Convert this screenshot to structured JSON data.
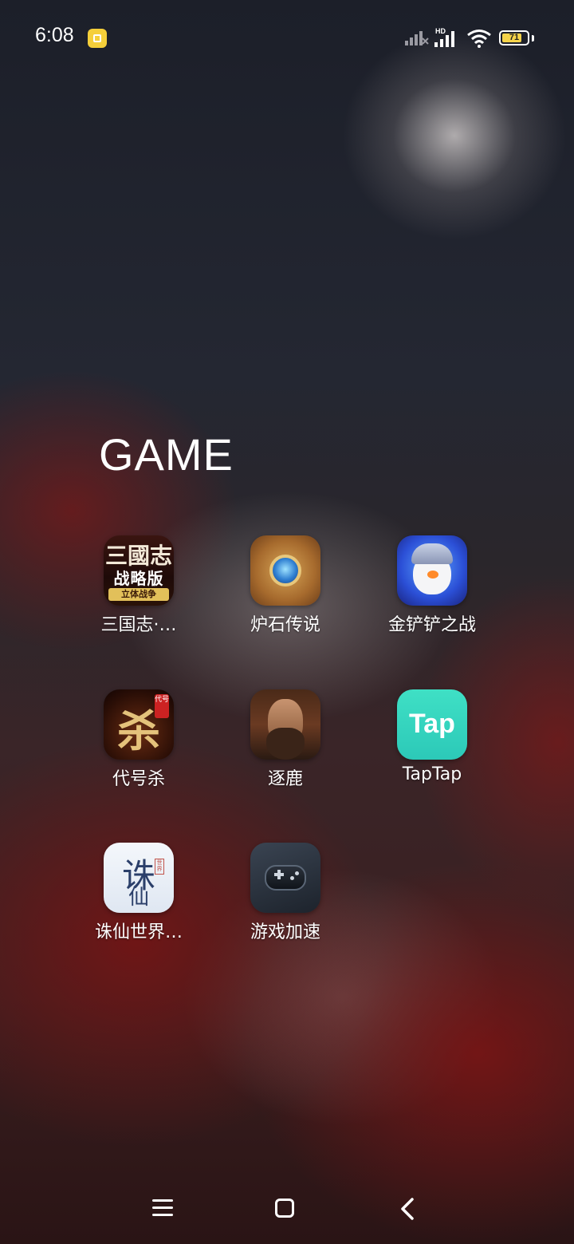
{
  "status_bar": {
    "time": "6:08",
    "network_label": "HD",
    "battery_level": "71"
  },
  "folder": {
    "title": "GAME",
    "apps": [
      {
        "label": "三国志·…",
        "icon": "sanguozhi-icon"
      },
      {
        "label": "炉石传说",
        "icon": "hearthstone-icon"
      },
      {
        "label": "金铲铲之战",
        "icon": "jinchanchan-icon"
      },
      {
        "label": "代号杀",
        "icon": "daihaosha-icon"
      },
      {
        "label": "逐鹿",
        "icon": "zhulu-icon"
      },
      {
        "label": "TapTap",
        "icon": "taptap-icon"
      },
      {
        "label": "诛仙世界…",
        "icon": "zhuxian-icon"
      },
      {
        "label": "游戏加速",
        "icon": "game-booster-icon"
      }
    ]
  },
  "icon_text": {
    "sanguozhi_line1": "三國志",
    "sanguozhi_line2": "战略版",
    "sanguozhi_band": "立体战争",
    "daihaosha_main": "杀",
    "daihaosha_tag": "代号",
    "taptap": "Tap",
    "zhuxian_line1": "诛",
    "zhuxian_line2": "仙",
    "zhuxian_seal": "世界"
  },
  "navigation": {
    "menu": "menu-icon",
    "home": "home-icon",
    "back": "back-icon"
  },
  "colors": {
    "notification": "#f5cf3a",
    "battery_fill": "#f5d34a",
    "taptap": "#2cc9b8"
  }
}
